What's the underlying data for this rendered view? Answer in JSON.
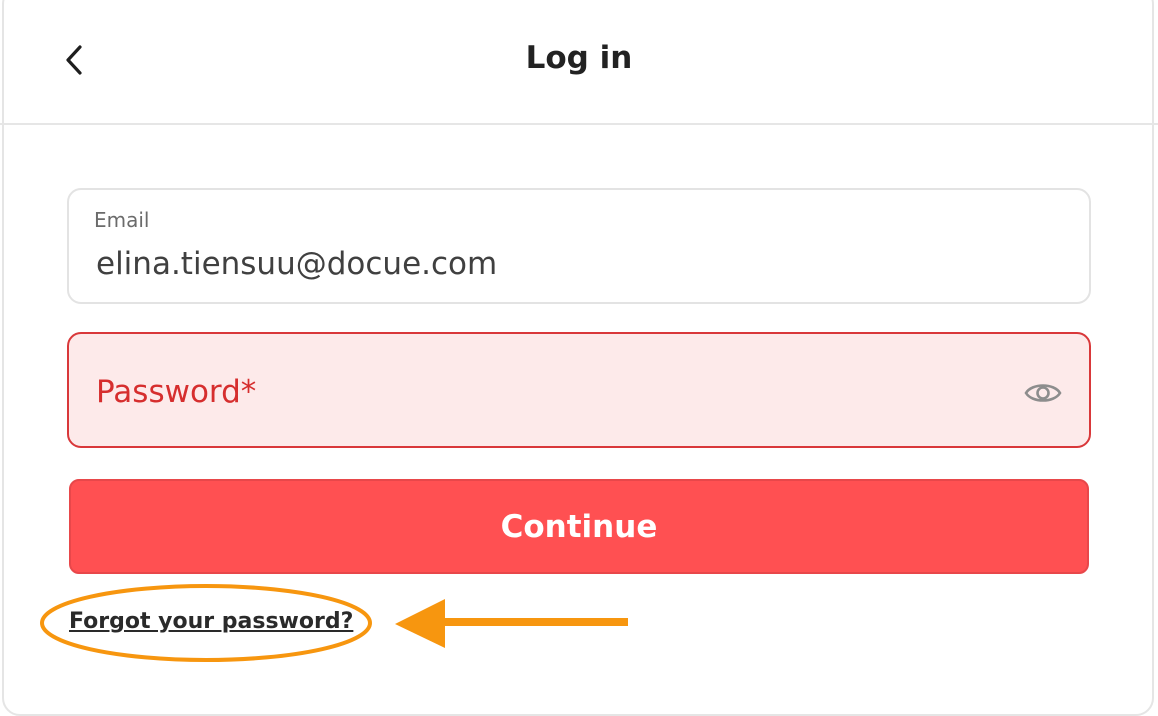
{
  "header": {
    "title": "Log in",
    "back_icon": "chevron-left-icon"
  },
  "form": {
    "email": {
      "label": "Email",
      "value": "elina.tiensuu@docue.com"
    },
    "password": {
      "label": "Password*",
      "state": "error",
      "toggle_icon": "eye-icon"
    },
    "continue_label": "Continue",
    "forgot_label": "Forgot your password?"
  },
  "annotation": {
    "color": "#f7960f",
    "shapes": [
      "ellipse",
      "arrow"
    ]
  },
  "colors": {
    "accent": "#ff5052",
    "error_text": "#d62e2e",
    "error_bg": "#fdeaea"
  }
}
